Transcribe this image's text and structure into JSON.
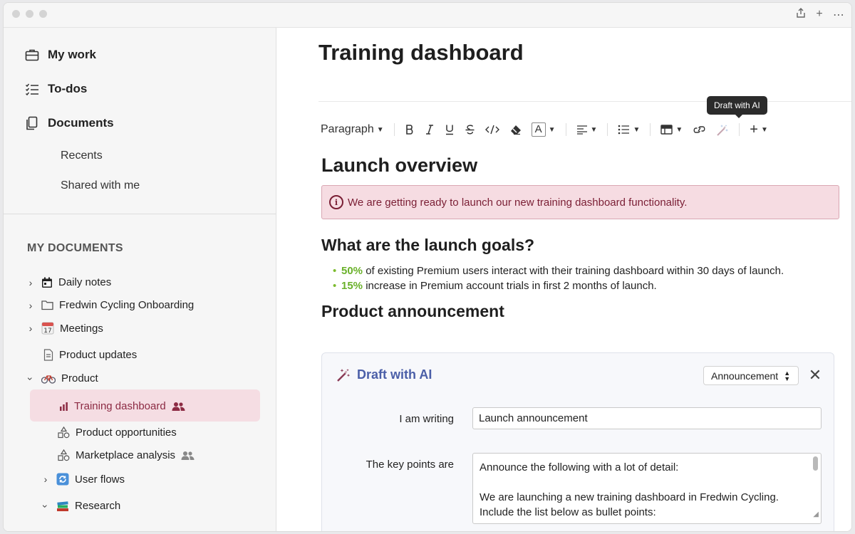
{
  "titlebar": {
    "icons": [
      "share-icon",
      "plus-icon",
      "more-icon"
    ]
  },
  "sidebar": {
    "nav": [
      {
        "label": "My work",
        "icon": "briefcase-icon"
      },
      {
        "label": "To-dos",
        "icon": "checklist-icon"
      },
      {
        "label": "Documents",
        "icon": "documents-icon"
      }
    ],
    "doc_subnav": [
      "Recents",
      "Shared with me"
    ],
    "section_title": "MY DOCUMENTS",
    "tree": [
      {
        "label": "Daily notes",
        "icon": "calendar-icon"
      },
      {
        "label": "Fredwin Cycling Onboarding",
        "icon": "folder-icon"
      },
      {
        "label": "Meetings",
        "icon": "date-17-icon"
      },
      {
        "label": "Product updates",
        "icon": "page-icon"
      },
      {
        "label": "Product",
        "icon": "bicycle-icon"
      },
      {
        "label": "Training dashboard",
        "icon": "bar-chart-icon"
      },
      {
        "label": "Product opportunities",
        "icon": "shapes-icon"
      },
      {
        "label": "Marketplace analysis",
        "icon": "shapes-icon"
      },
      {
        "label": "User flows",
        "icon": "refresh-icon"
      },
      {
        "label": "Research",
        "icon": "books-icon"
      }
    ]
  },
  "doc": {
    "title": "Training dashboard",
    "tooltip": "Draft with AI",
    "toolbar": {
      "paragraph": "Paragraph",
      "font_color_letter": "A"
    },
    "h_launch": "Launch overview",
    "callout": "We are getting ready to launch our new training dashboard functionality.",
    "h_goals": "What are the launch goals?",
    "goals": [
      {
        "pct": "50%",
        "text": " of existing Premium users interact with their training dashboard within 30 days of launch."
      },
      {
        "pct": "15%",
        "text": " increase in Premium account trials in first 2 months of launch."
      }
    ],
    "h_announcement": "Product announcement"
  },
  "ai_panel": {
    "title": "Draft with AI",
    "type_select": "Announcement",
    "writing_label": "I am writing",
    "writing_value": "Launch announcement",
    "keypoints_label": "The key points are",
    "keypoints_line1": "Announce the following with a lot of detail:",
    "keypoints_line2": "We are launching a new training dashboard in Fredwin Cycling.",
    "keypoints_line3": "Include the list below as bullet points:"
  },
  "colors": {
    "accent": "#f5dde3",
    "callout_text": "#7a1e34",
    "ai_title": "#4b5fa8",
    "goal_pct": "#6ab12a"
  }
}
